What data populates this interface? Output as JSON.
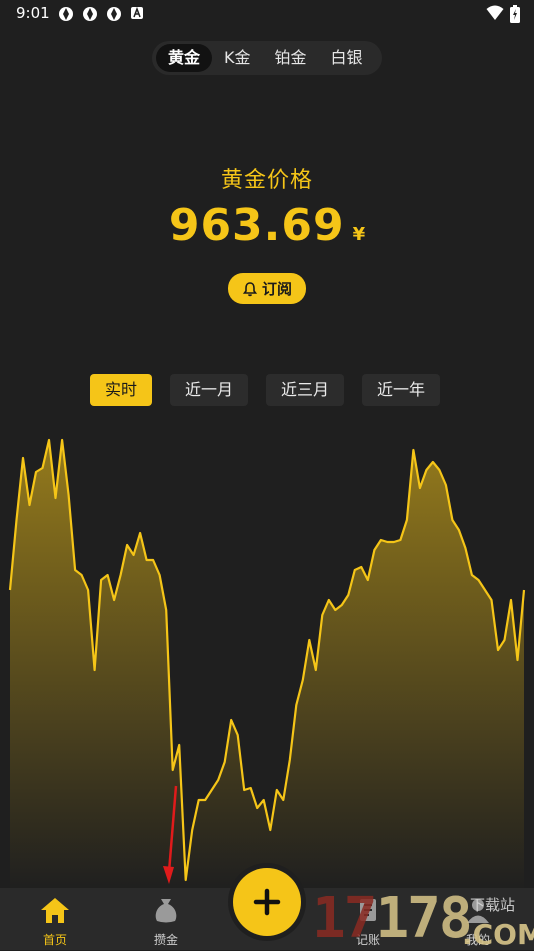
{
  "status": {
    "time": "9:01"
  },
  "metal_tabs": [
    {
      "label": "黄金",
      "active": true
    },
    {
      "label": "K金",
      "active": false
    },
    {
      "label": "铂金",
      "active": false
    },
    {
      "label": "白银",
      "active": false
    }
  ],
  "price": {
    "title": "黄金价格",
    "value": "963.69",
    "unit": "¥"
  },
  "subscribe_label": "订阅",
  "range_tabs": [
    {
      "label": "实时",
      "active": true
    },
    {
      "label": "近一月",
      "active": false
    },
    {
      "label": "近三月",
      "active": false
    },
    {
      "label": "近一年",
      "active": false
    }
  ],
  "chart_data": {
    "type": "area",
    "y": [
      590,
      520,
      458,
      505,
      472,
      468,
      440,
      498,
      440,
      495,
      570,
      575,
      590,
      670,
      580,
      575,
      600,
      575,
      545,
      555,
      533,
      560,
      560,
      575,
      610,
      770,
      745,
      880,
      830,
      800,
      800,
      790,
      780,
      762,
      720,
      735,
      790,
      788,
      808,
      800,
      830,
      790,
      800,
      760,
      705,
      680,
      640,
      670,
      615,
      600,
      610,
      605,
      595,
      570,
      567,
      580,
      550,
      540,
      542,
      542,
      540,
      520,
      450,
      488,
      470,
      462,
      470,
      485,
      520,
      530,
      548,
      575,
      580,
      590,
      600,
      650,
      640,
      600,
      660,
      590
    ],
    "color": "#f5c518"
  },
  "bottom_nav": {
    "home": "首页",
    "gold_bag": "攒金",
    "records": "记账",
    "mine": "我的"
  },
  "watermark": {
    "digits_a": "17",
    "digits_b": "178",
    "top": "下载站",
    "com": ".COM"
  },
  "colors": {
    "accent": "#f5c518",
    "background": "#1f1f1f",
    "nav_background": "#2a2a2a"
  }
}
